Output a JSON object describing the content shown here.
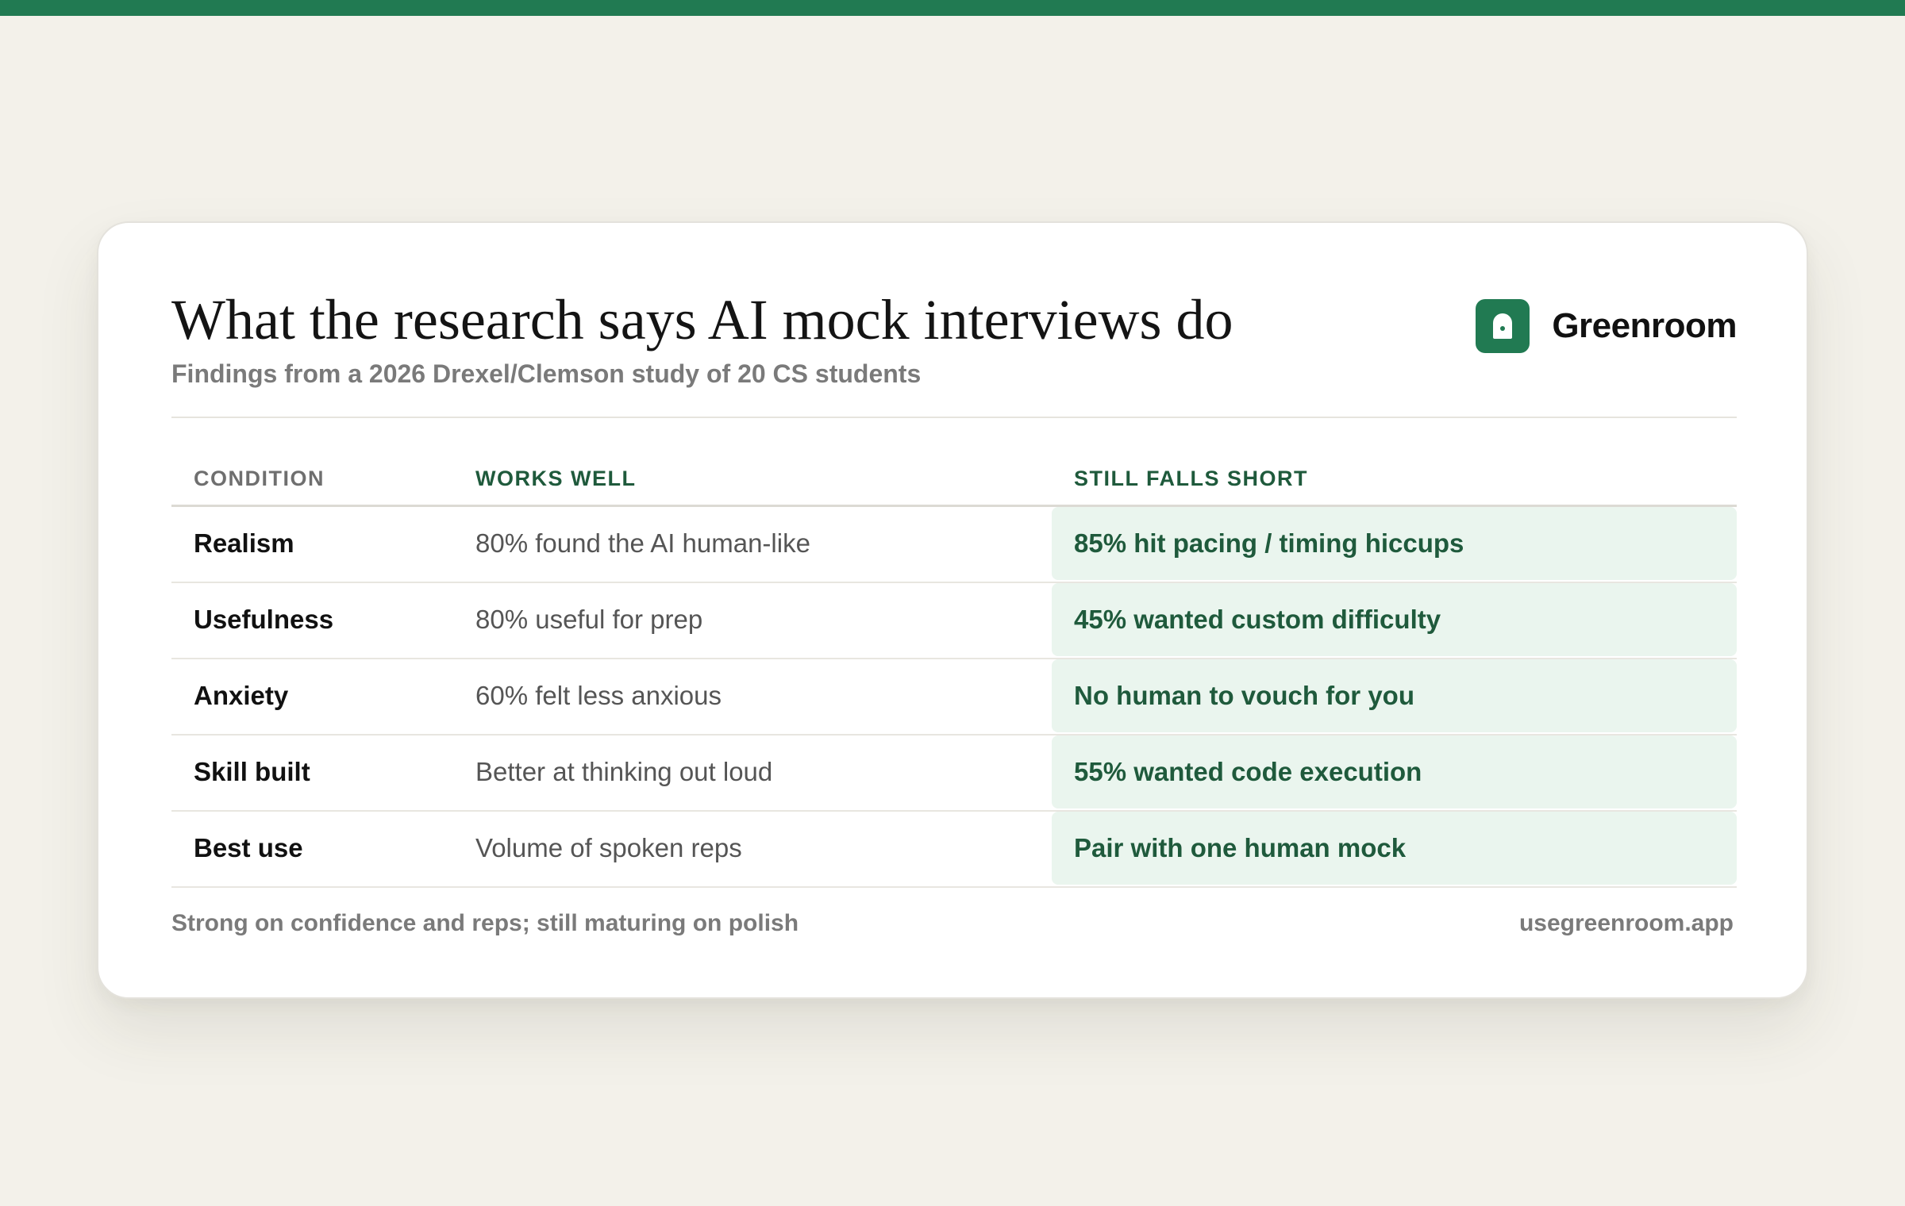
{
  "header": {
    "title": "What the research says AI mock interviews do",
    "subtitle": "Findings from a 2026 Drexel/Clemson study of 20 CS students"
  },
  "brand": {
    "name": "Greenroom",
    "logo_icon": "door-icon",
    "accent_color": "#217a52"
  },
  "table": {
    "headers": [
      "CONDITION",
      "WORKS WELL",
      "STILL FALLS SHORT"
    ],
    "rows": [
      {
        "condition": "Realism",
        "works_well": "80% found the AI human-like",
        "falls_short": "85% hit pacing / timing hiccups"
      },
      {
        "condition": "Usefulness",
        "works_well": "80% useful for prep",
        "falls_short": "45% wanted custom difficulty"
      },
      {
        "condition": "Anxiety",
        "works_well": "60% felt less anxious",
        "falls_short": "No human to vouch for you"
      },
      {
        "condition": "Skill built",
        "works_well": "Better at thinking out loud",
        "falls_short": "55% wanted code execution"
      },
      {
        "condition": "Best use",
        "works_well": "Volume of spoken reps",
        "falls_short": "Pair with one human mock"
      }
    ]
  },
  "footer": {
    "note": "Strong on confidence and reps; still maturing on polish",
    "url": "usegreenroom.app"
  }
}
